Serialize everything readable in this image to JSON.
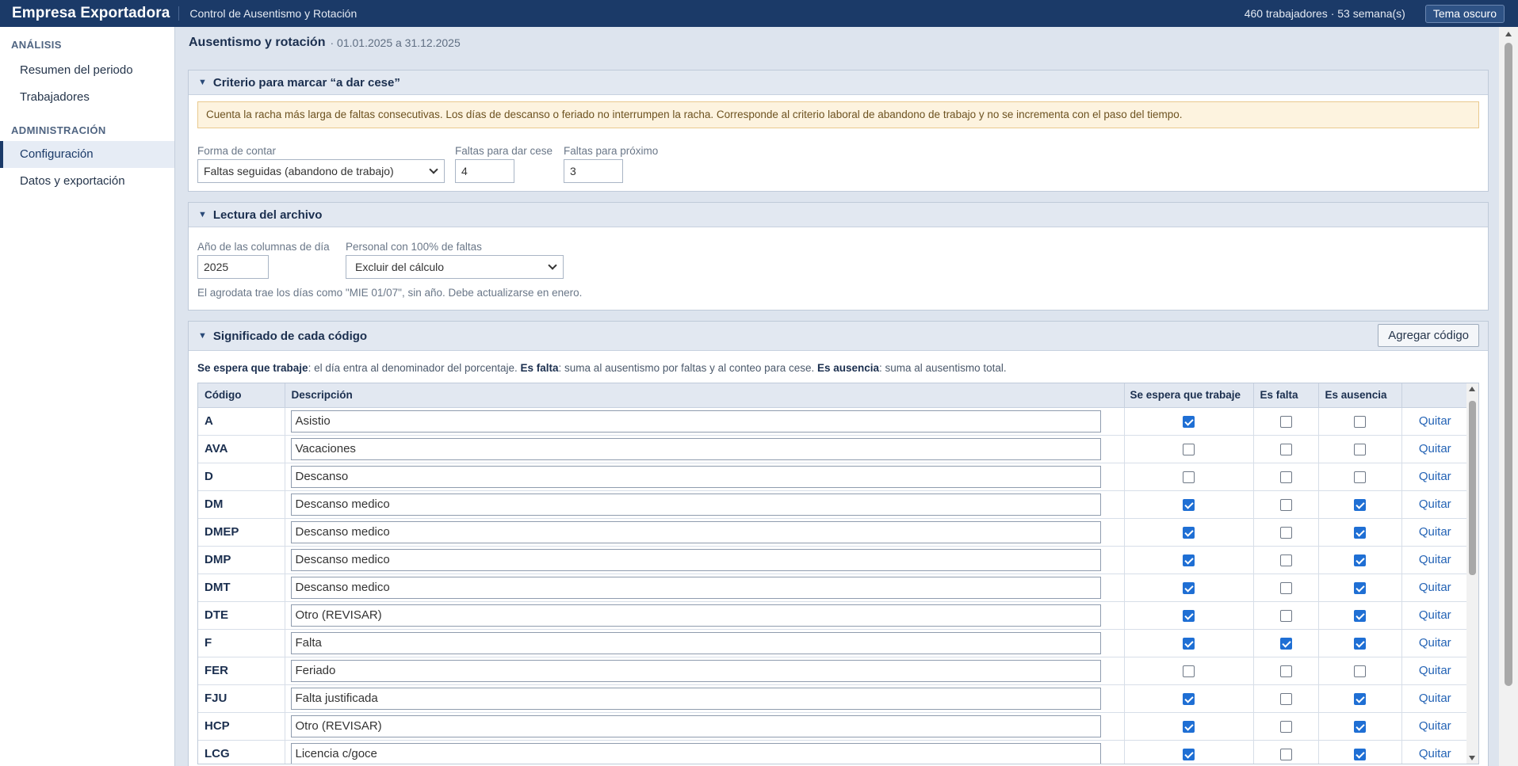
{
  "header": {
    "brand": "Empresa Exportadora",
    "subtitle": "Control de Ausentismo y Rotación",
    "counts": "460 trabajadores · 53 semana(s)",
    "theme_button": "Tema oscuro"
  },
  "sidebar": {
    "section1": "ANÁLISIS",
    "section1_items": [
      {
        "label": "Resumen del periodo"
      },
      {
        "label": "Trabajadores"
      }
    ],
    "section2": "ADMINISTRACIÓN",
    "section2_items": [
      {
        "label": "Configuración",
        "active": true
      },
      {
        "label": "Datos y exportación"
      }
    ]
  },
  "page": {
    "title": "Ausentismo y rotación",
    "range": "· 01.01.2025 a 31.12.2025"
  },
  "criterio": {
    "title": "Criterio para marcar “a dar cese”",
    "notice": "Cuenta la racha más larga de faltas consecutivas. Los días de descanso o feriado no interrumpen la racha. Corresponde al criterio laboral de abandono de trabajo y no se incrementa con el paso del tiempo.",
    "forma_label": "Forma de contar",
    "forma_value": "Faltas seguidas (abandono de trabajo)",
    "cese_label": "Faltas para dar cese",
    "cese_value": "4",
    "proximo_label": "Faltas para próximo",
    "proximo_value": "3"
  },
  "lectura": {
    "title": "Lectura del archivo",
    "anio_label": "Año de las columnas de día",
    "anio_value": "2025",
    "personal_label": "Personal con 100% de faltas",
    "personal_value": "Excluir del cálculo",
    "hint": "El agrodata trae los días como \"MIE 01/07\", sin año. Debe actualizarse en enero."
  },
  "codigos": {
    "title": "Significado de cada código",
    "add_button": "Agregar código",
    "legend_1b": "Se espera que trabaje",
    "legend_1": ": el día entra al denominador del porcentaje. ",
    "legend_2b": "Es falta",
    "legend_2": ": suma al ausentismo por faltas y al conteo para cese. ",
    "legend_3b": "Es ausencia",
    "legend_3": ": suma al ausentismo total.",
    "columns": {
      "codigo": "Código",
      "descripcion": "Descripción",
      "espera": "Se espera que trabaje",
      "falta": "Es falta",
      "ausencia": "Es ausencia"
    },
    "remove_label": "Quitar",
    "rows": [
      {
        "code": "A",
        "desc": "Asistio",
        "espera": true,
        "falta": false,
        "ausencia": false
      },
      {
        "code": "AVA",
        "desc": "Vacaciones",
        "espera": false,
        "falta": false,
        "ausencia": false
      },
      {
        "code": "D",
        "desc": "Descanso",
        "espera": false,
        "falta": false,
        "ausencia": false
      },
      {
        "code": "DM",
        "desc": "Descanso medico",
        "espera": true,
        "falta": false,
        "ausencia": true
      },
      {
        "code": "DMEP",
        "desc": "Descanso medico",
        "espera": true,
        "falta": false,
        "ausencia": true
      },
      {
        "code": "DMP",
        "desc": "Descanso medico",
        "espera": true,
        "falta": false,
        "ausencia": true
      },
      {
        "code": "DMT",
        "desc": "Descanso medico",
        "espera": true,
        "falta": false,
        "ausencia": true
      },
      {
        "code": "DTE",
        "desc": "Otro (REVISAR)",
        "espera": true,
        "falta": false,
        "ausencia": true
      },
      {
        "code": "F",
        "desc": "Falta",
        "espera": true,
        "falta": true,
        "ausencia": true
      },
      {
        "code": "FER",
        "desc": "Feriado",
        "espera": false,
        "falta": false,
        "ausencia": false
      },
      {
        "code": "FJU",
        "desc": "Falta justificada",
        "espera": true,
        "falta": false,
        "ausencia": true
      },
      {
        "code": "HCP",
        "desc": "Otro (REVISAR)",
        "espera": true,
        "falta": false,
        "ausencia": true
      },
      {
        "code": "LCG",
        "desc": "Licencia c/goce",
        "espera": true,
        "falta": false,
        "ausencia": true
      }
    ]
  },
  "colors": {
    "topbar": "#1b3a68",
    "accent": "#1f6fd4",
    "notice_bg": "#fdf3df",
    "link": "#2463b5"
  }
}
